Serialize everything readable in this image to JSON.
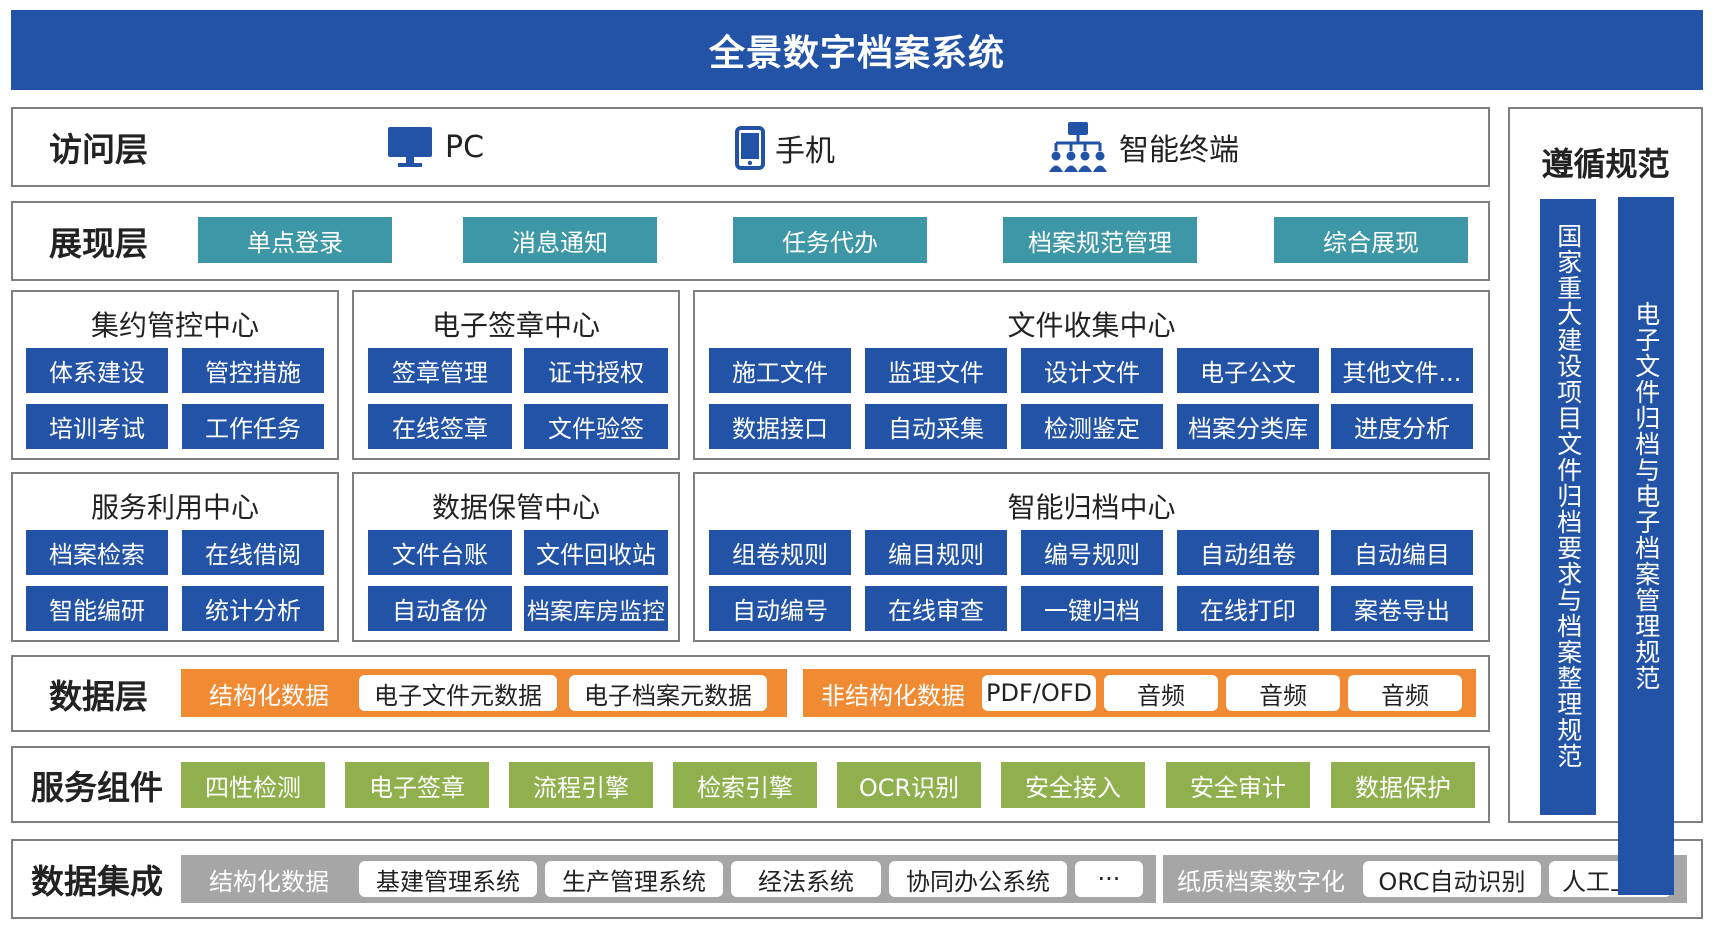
{
  "title": "全景数字档案系统",
  "access_layer": {
    "label": "访问层",
    "items": [
      {
        "icon": "monitor-icon",
        "label": "PC"
      },
      {
        "icon": "phone-icon",
        "label": "手机"
      },
      {
        "icon": "network-icon",
        "label": "智能终端"
      }
    ]
  },
  "display_layer": {
    "label": "展现层",
    "items": [
      "单点登录",
      "消息通知",
      "任务代办",
      "档案规范管理",
      "综合展现"
    ]
  },
  "centers": {
    "c1": {
      "title": "集约管控中心",
      "items": [
        "体系建设",
        "管控措施",
        "培训考试",
        "工作任务"
      ]
    },
    "c2": {
      "title": "电子签章中心",
      "items": [
        "签章管理",
        "证书授权",
        "在线签章",
        "文件验签"
      ]
    },
    "c3": {
      "title": "文件收集中心",
      "items": [
        "施工文件",
        "监理文件",
        "设计文件",
        "电子公文",
        "其他文件...",
        "数据接口",
        "自动采集",
        "检测鉴定",
        "档案分类库",
        "进度分析"
      ]
    },
    "c4": {
      "title": "服务利用中心",
      "items": [
        "档案检索",
        "在线借阅",
        "智能编研",
        "统计分析"
      ]
    },
    "c5": {
      "title": "数据保管中心",
      "items": [
        "文件台账",
        "文件回收站",
        "自动备份",
        "档案库房监控"
      ]
    },
    "c6": {
      "title": "智能归档中心",
      "items": [
        "组卷规则",
        "编目规则",
        "编号规则",
        "自动组卷",
        "自动编目",
        "自动编号",
        "在线审查",
        "一键归档",
        "在线打印",
        "案卷导出"
      ]
    }
  },
  "data_layer": {
    "label": "数据层",
    "structured": {
      "label": "结构化数据",
      "items": [
        "电子文件元数据",
        "电子档案元数据"
      ]
    },
    "unstructured": {
      "label": "非结构化数据",
      "items": [
        "PDF/OFD",
        "音频",
        "音频",
        "音频"
      ]
    }
  },
  "service_components": {
    "label": "服务组件",
    "items": [
      "四性检测",
      "电子签章",
      "流程引擎",
      "检索引擎",
      "OCR识别",
      "安全接入",
      "安全审计",
      "数据保护"
    ]
  },
  "data_integration": {
    "label": "数据集成",
    "structured": {
      "label": "结构化数据",
      "items": [
        "基建管理系统",
        "生产管理系统",
        "经法系统",
        "协同办公系统",
        "···"
      ]
    },
    "paper": {
      "label": "纸质档案数字化",
      "items": [
        "ORC自动识别",
        "人工上传"
      ]
    }
  },
  "compliance": {
    "title": "遵循规范",
    "items": [
      "国家重大建设项目文件归档要求与档案整理规范",
      "电子文件归档与电子档案管理规范"
    ]
  },
  "colors": {
    "primary_blue": "#2253a6",
    "teal": "#3d97a6",
    "orange": "#f08a33",
    "green": "#8fb04d",
    "gray": "#a6a6a6",
    "border": "#7f7f7f"
  }
}
